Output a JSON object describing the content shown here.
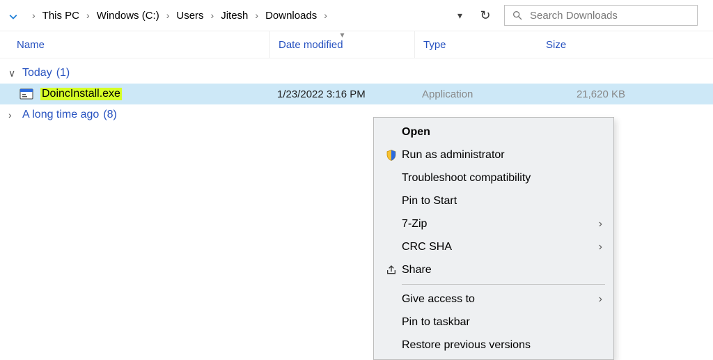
{
  "breadcrumb": {
    "items": [
      "This PC",
      "Windows (C:)",
      "Users",
      "Jitesh",
      "Downloads"
    ]
  },
  "search": {
    "placeholder": "Search Downloads"
  },
  "columns": {
    "name": "Name",
    "date": "Date modified",
    "type": "Type",
    "size": "Size"
  },
  "groups": {
    "today": {
      "label": "Today",
      "count": "(1)"
    },
    "old": {
      "label": "A long time ago",
      "count": "(8)"
    }
  },
  "file": {
    "name": "DoincInstall.exe",
    "date": "1/23/2022 3:16 PM",
    "type": "Application",
    "size": "21,620 KB"
  },
  "ctx": {
    "open": "Open",
    "runadmin": "Run as administrator",
    "troubleshoot": "Troubleshoot compatibility",
    "pinstart": "Pin to Start",
    "sevenzip": "7-Zip",
    "crcsha": "CRC SHA",
    "share": "Share",
    "giveaccess": "Give access to",
    "pintaskbar": "Pin to taskbar",
    "restoreprev": "Restore previous versions"
  }
}
